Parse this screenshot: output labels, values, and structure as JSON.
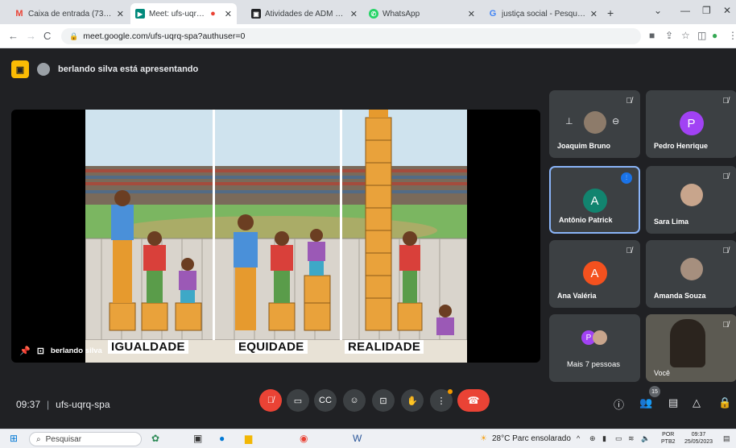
{
  "browser": {
    "tabs": [
      {
        "label": "Caixa de entrada (738) - arte",
        "icon": "gmail-icon"
      },
      {
        "label": "Meet: ufs-uqrq-spa",
        "icon": "meet-icon"
      },
      {
        "label": "",
        "icon": "recording-icon"
      },
      {
        "label": "Atividades de ADM 20 Profe",
        "icon": "classroom-icon"
      },
      {
        "label": "WhatsApp",
        "icon": "whatsapp-icon"
      },
      {
        "label": "justiça social - Pesquisa Goo",
        "icon": "google-icon"
      }
    ],
    "url": "meet.google.com/ufs-uqrq-spa?authuser=0"
  },
  "meet": {
    "presenter_banner": "berlando silva está apresentando",
    "presenter_label": "berlando silva",
    "slide_labels": [
      "IGUALDADE",
      "EQUIDADE",
      "REALIDADE"
    ],
    "participants": [
      {
        "name": "Joaquim Bruno",
        "type": "photo"
      },
      {
        "name": "Pedro Henrique",
        "type": "letter",
        "letter": "P",
        "color": "#a142f4"
      },
      {
        "name": "Antônio Patrick",
        "type": "letter",
        "letter": "A",
        "color": "#12846f",
        "speaking": true
      },
      {
        "name": "Sara Lima",
        "type": "photo"
      },
      {
        "name": "Ana Valéria",
        "type": "letter",
        "letter": "A",
        "color": "#f4511e"
      },
      {
        "name": "Amanda Souza",
        "type": "photo"
      },
      {
        "name": "Mais 7 pessoas",
        "type": "more",
        "letter": "P"
      },
      {
        "name": "Você",
        "type": "video"
      }
    ],
    "time": "09:37",
    "meeting_code": "ufs-uqrq-spa",
    "people_count": "15"
  },
  "taskbar": {
    "search_placeholder": "Pesquisar",
    "weather": "28°C  Parc ensolarado",
    "lang_top": "POR",
    "lang_bottom": "PTB2",
    "clock_time": "09:37",
    "clock_date": "25/05/2023"
  }
}
